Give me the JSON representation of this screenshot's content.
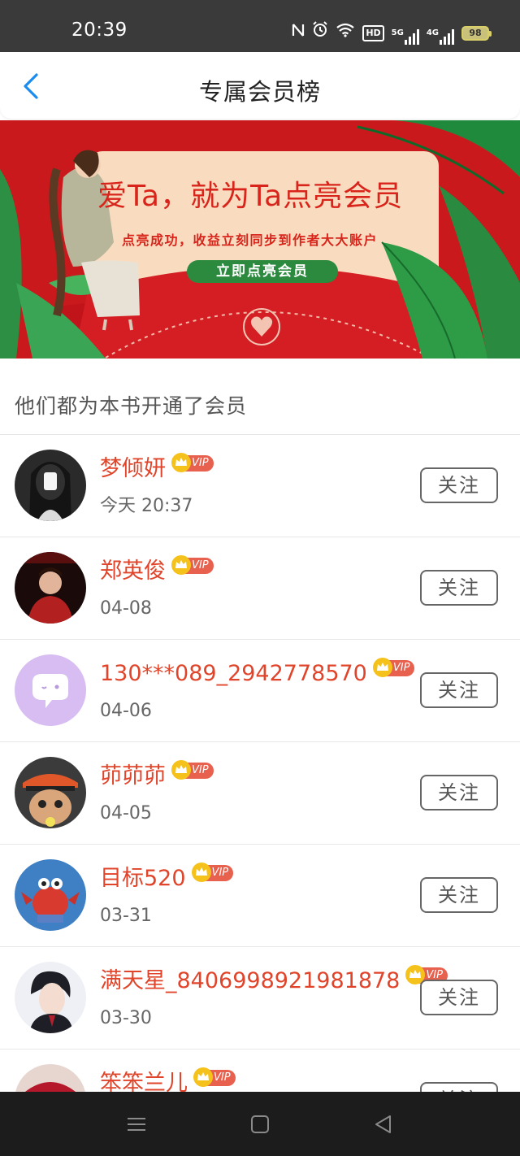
{
  "status_bar": {
    "time": "20:39",
    "icons": [
      "nfc-icon",
      "alarm-icon",
      "wifi-icon",
      "hd-icon",
      "signal-5g-icon",
      "signal-4g-icon",
      "battery-icon"
    ],
    "hd_label": "HD",
    "net_5g": "5G",
    "net_4g": "4G",
    "battery": "98"
  },
  "nav": {
    "title": "专属会员榜",
    "back_icon": "chevron-left-icon",
    "accent": "#1a8cf0"
  },
  "banner": {
    "headline": "爱Ta，就为Ta点亮会员",
    "subline": "点亮成功，收益立刻同步到作者大大账户",
    "button_label": "立即点亮会员",
    "bg_color": "#c9191c",
    "card_color": "#f9dcbf"
  },
  "section": {
    "title": "他们都为本书开通了会员"
  },
  "members": [
    {
      "name": "梦倾妍",
      "vip": "VIP",
      "date": "今天 20:37",
      "follow_label": "关注",
      "avatar": "avatar-photo-girl"
    },
    {
      "name": "郑英俊",
      "vip": "VIP",
      "date": "04-08",
      "follow_label": "关注",
      "avatar": "avatar-photo-boy-red"
    },
    {
      "name": "130***089_2942778570",
      "vip": "VIP",
      "date": "04-06",
      "follow_label": "关注",
      "avatar": "default-chat-bubble-avatar"
    },
    {
      "name": "茆茆茆",
      "vip": "VIP",
      "date": "04-05",
      "follow_label": "关注",
      "avatar": "avatar-cartoon-cap"
    },
    {
      "name": "目标520",
      "vip": "VIP",
      "date": "03-31",
      "follow_label": "关注",
      "avatar": "avatar-crab-cartoon"
    },
    {
      "name": "满天星_8406998921981878",
      "vip": "VIP",
      "date": "03-30",
      "follow_label": "关注",
      "avatar": "avatar-anime-boy"
    },
    {
      "name": "笨笨兰儿",
      "vip": "VIP",
      "date": "",
      "follow_label": "关注",
      "avatar": "avatar-red-hat"
    }
  ],
  "colors": {
    "name_color": "#e0452b",
    "vip_color": "#e8604e",
    "crown_color": "#f5c21b"
  },
  "system_nav": {
    "icons": [
      "menu-icon",
      "home-square-icon",
      "back-triangle-icon"
    ]
  }
}
